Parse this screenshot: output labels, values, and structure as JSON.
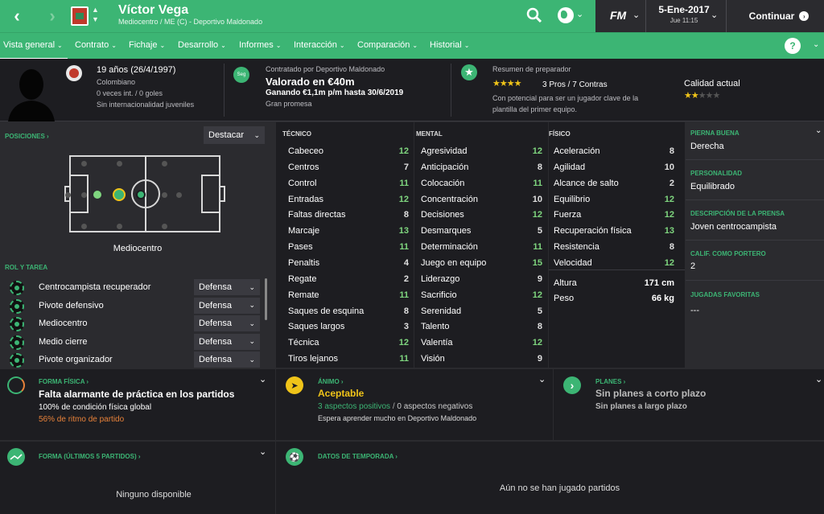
{
  "topbar": {
    "back": "‹",
    "forward": "›",
    "player_name": "Víctor Vega",
    "player_sub": "Mediocentro / ME (C) - Deportivo Maldonado",
    "fm": "FM",
    "date": "5-Ene-2017",
    "time": "Jue 11:15",
    "continue_label": "Continuar",
    "accent": "#3cb574"
  },
  "nav": {
    "items": [
      "Vista general",
      "Contrato",
      "Fichaje",
      "Desarrollo",
      "Informes",
      "Interacción",
      "Comparación",
      "Historial"
    ],
    "help": "?"
  },
  "header": {
    "age": "19 años (26/4/1997)",
    "nationality": "Colombiano",
    "intl": "0 veces int. / 0 goles",
    "youth": "Sin internacionalidad juveniles",
    "seg": "Seg",
    "contracted": "Contratado por Deportivo Maldonado",
    "value": "Valorado en €40m",
    "wage": "Ganando €1,1m p/m hasta 30/6/2019",
    "status": "Gran promesa",
    "coach_title": "Resumen de preparador",
    "pros_cons": "3 Pros / 7 Contras",
    "coach_text_1": "Con potencial para ser un jugador clave de la",
    "coach_text_2": "plantilla del primer equipo.",
    "quality_label": "Calidad actual",
    "coach_stars": 4,
    "quality_stars": 2
  },
  "positions": {
    "title": "POSICIONES",
    "highlight": "Destacar",
    "position_name": "Mediocentro"
  },
  "roles": {
    "title": "ROL Y TAREA",
    "items": [
      {
        "name": "Centrocampista recuperador",
        "duty": "Defensa"
      },
      {
        "name": "Pivote defensivo",
        "duty": "Defensa"
      },
      {
        "name": "Mediocentro",
        "duty": "Defensa"
      },
      {
        "name": "Medio cierre",
        "duty": "Defensa"
      },
      {
        "name": "Pivote organizador",
        "duty": "Defensa"
      }
    ]
  },
  "attributes": {
    "tecnico_title": "TÉCNICO",
    "mental_title": "MENTAL",
    "fisico_title": "FÍSICO",
    "tecnico": [
      {
        "n": "Cabeceo",
        "v": "12"
      },
      {
        "n": "Centros",
        "v": "7"
      },
      {
        "n": "Control",
        "v": "11"
      },
      {
        "n": "Entradas",
        "v": "12"
      },
      {
        "n": "Faltas directas",
        "v": "8"
      },
      {
        "n": "Marcaje",
        "v": "13"
      },
      {
        "n": "Pases",
        "v": "11"
      },
      {
        "n": "Penaltis",
        "v": "4"
      },
      {
        "n": "Regate",
        "v": "2"
      },
      {
        "n": "Remate",
        "v": "11"
      },
      {
        "n": "Saques de esquina",
        "v": "8"
      },
      {
        "n": "Saques largos",
        "v": "3"
      },
      {
        "n": "Técnica",
        "v": "12"
      },
      {
        "n": "Tiros lejanos",
        "v": "11"
      }
    ],
    "mental": [
      {
        "n": "Agresividad",
        "v": "12"
      },
      {
        "n": "Anticipación",
        "v": "8"
      },
      {
        "n": "Colocación",
        "v": "11"
      },
      {
        "n": "Concentración",
        "v": "10"
      },
      {
        "n": "Decisiones",
        "v": "12"
      },
      {
        "n": "Desmarques",
        "v": "5"
      },
      {
        "n": "Determinación",
        "v": "11"
      },
      {
        "n": "Juego en equipo",
        "v": "15"
      },
      {
        "n": "Liderazgo",
        "v": "9"
      },
      {
        "n": "Sacrificio",
        "v": "12"
      },
      {
        "n": "Serenidad",
        "v": "5"
      },
      {
        "n": "Talento",
        "v": "8"
      },
      {
        "n": "Valentía",
        "v": "12"
      },
      {
        "n": "Visión",
        "v": "9"
      }
    ],
    "fisico": [
      {
        "n": "Aceleración",
        "v": "8"
      },
      {
        "n": "Agilidad",
        "v": "10"
      },
      {
        "n": "Alcance de salto",
        "v": "2"
      },
      {
        "n": "Equilibrio",
        "v": "12"
      },
      {
        "n": "Fuerza",
        "v": "12"
      },
      {
        "n": "Recuperación física",
        "v": "13"
      },
      {
        "n": "Resistencia",
        "v": "8"
      },
      {
        "n": "Velocidad",
        "v": "12"
      }
    ],
    "height_label": "Altura",
    "height": "171 cm",
    "weight_label": "Peso",
    "weight": "66 kg"
  },
  "side": {
    "foot_label": "PIERNA BUENA",
    "foot": "Derecha",
    "personality_label": "PERSONALIDAD",
    "personality": "Equilibrado",
    "press_label": "DESCRIPCIÓN DE LA PRENSA",
    "press": "Joven centrocampista",
    "gk_label": "CALIF. COMO PORTERO",
    "gk": "2",
    "plays_label": "JUGADAS FAVORITAS",
    "plays": "---"
  },
  "bottom": {
    "fitness_title": "FORMA FÍSICA",
    "fitness_main": "Falta alarmante de práctica en los partidos",
    "fitness_line": "100% de condición física global",
    "fitness_rhythm": "56% de ritmo de partido",
    "morale_title": "ÁNIMO",
    "morale_main": "Aceptable",
    "morale_pos": "3 aspectos positivos",
    "morale_slash": "/",
    "morale_neg": "0 aspectos negativos",
    "morale_line": "Espera aprender mucho en Deportivo Maldonado",
    "plans_title": "PLANES",
    "plans_main": "Sin planes a corto plazo",
    "plans_line": "Sin planes a largo plazo",
    "form_title": "FORMA (ÚLTIMOS 5 PARTIDOS)",
    "form_empty": "Ninguno disponible",
    "season_title": "DATOS DE TEMPORADA",
    "season_empty": "Aún no se han jugado partidos",
    "orange": "#e8823a",
    "yellow": "#f0c419"
  }
}
